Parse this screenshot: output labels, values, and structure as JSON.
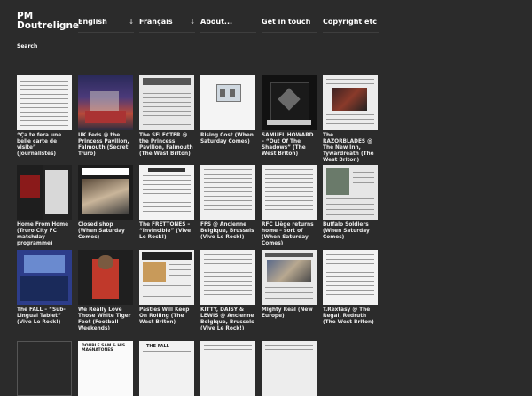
{
  "site": {
    "title_line1": "PM",
    "title_line2": "Doutreligne"
  },
  "nav": [
    {
      "label": "English",
      "has_dropdown": true
    },
    {
      "label": "Français",
      "has_dropdown": true
    },
    {
      "label": "About...",
      "has_dropdown": false
    },
    {
      "label": "Get in touch",
      "has_dropdown": false
    },
    {
      "label": "Copyright etc",
      "has_dropdown": false
    }
  ],
  "nav_arrow": "↓",
  "search": {
    "label": "Search"
  },
  "posts": [
    {
      "caption": "“Ça te fera une belle carte de visite” (Journalistes)",
      "thumb": "text-page"
    },
    {
      "caption": "UK Feds @ the Princess Pavilion, Falmouth (Secret Truro)",
      "thumb": "photo-colour"
    },
    {
      "caption": "The SELECTER @ the Princess Pavilion, Falmouth (The West Briton)",
      "thumb": "newspaper"
    },
    {
      "caption": "Rising Cost (When Saturday Comes)",
      "thumb": "illustration"
    },
    {
      "caption": "SAMUEL HOWARD – “Out Of The Shadows” (The West Briton)",
      "thumb": "album-cover"
    },
    {
      "caption": "The RAZORBLADES @ The New Inn, Tywardreath (The West Briton)",
      "thumb": "newspaper-photo"
    },
    {
      "caption": "Home From Home (Truro City FC matchday programme)",
      "thumb": "photo-dark"
    },
    {
      "caption": "Closed shop (When Saturday Comes)",
      "thumb": "magazine"
    },
    {
      "caption": "The FRETTONES – “Invincible” (Vive Le Rock!)",
      "thumb": "text-page"
    },
    {
      "caption": "FFS @ Ancienne Belgique, Brussels (Vive Le Rock!)",
      "thumb": "text-page-2"
    },
    {
      "caption": "RFC Liège returns home – sort of (When Saturday Comes)",
      "thumb": "text-page-3"
    },
    {
      "caption": "Buffalo Soldiers (When Saturday Comes)",
      "thumb": "magazine-2"
    },
    {
      "caption": "The FALL – “Sub-Lingual Tablet” (Vive Le Rock!)",
      "thumb": "album-blue"
    },
    {
      "caption": "We Really Love Those White Tiger Feet (Football Weekends)",
      "thumb": "photo-red"
    },
    {
      "caption": "Pasties Will Keep On Rolling (The West Briton)",
      "thumb": "newspaper-food"
    },
    {
      "caption": "KITTY, DAISY & LEWIS @ Ancienne Belgique, Brussels (Vive Le Rock!)",
      "thumb": "text-page-4"
    },
    {
      "caption": "Mighty Real (New Europe)",
      "thumb": "arts-page"
    },
    {
      "caption": "T.Rextasy @ The Regal, Redruth (The West Briton)",
      "thumb": "text-page-5"
    }
  ],
  "partial_row": [
    {
      "thumb": "text-dark-1"
    },
    {
      "thumb": "poster"
    },
    {
      "thumb": "text-the-fall"
    },
    {
      "thumb": "text-page-6"
    },
    {
      "thumb": "text-page-7"
    }
  ],
  "partial_text": {
    "poster": "DOUBLE SAM & HIS MAGNATONES",
    "the_fall": "THE FALL"
  }
}
